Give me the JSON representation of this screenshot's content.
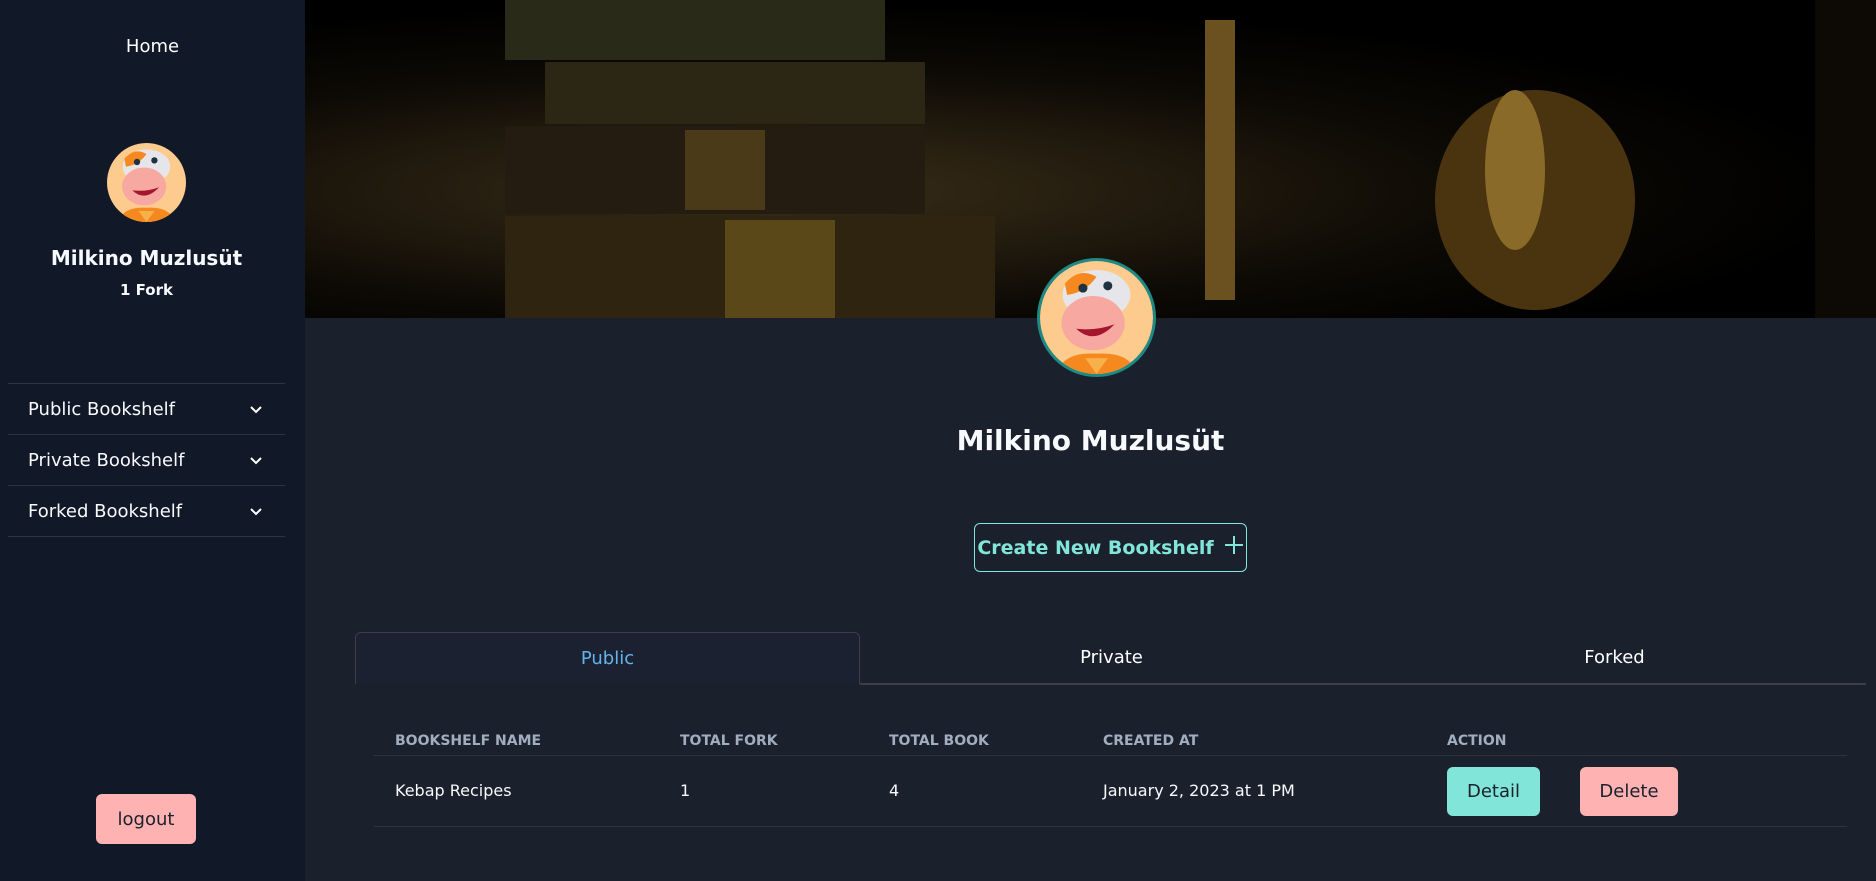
{
  "sidebar": {
    "home": "Home",
    "user_name": "Milkino Muzlusüt",
    "fork_count": "1 Fork",
    "items": [
      {
        "label": "Public Bookshelf"
      },
      {
        "label": "Private Bookshelf"
      },
      {
        "label": "Forked Bookshelf"
      }
    ],
    "logout": "logout"
  },
  "profile": {
    "name": "Milkino Muzlusüt",
    "create_button": "Create New Bookshelf"
  },
  "tabs": [
    {
      "label": "Public"
    },
    {
      "label": "Private"
    },
    {
      "label": "Forked"
    }
  ],
  "table": {
    "headers": [
      "BOOKSHELF NAME",
      "TOTAL FORK",
      "TOTAL BOOK",
      "CREATED AT",
      "ACTION"
    ],
    "rows": [
      {
        "name": "Kebap Recipes",
        "forks": "1",
        "books": "4",
        "created": "January 2, 2023 at 1 PM",
        "detail": "Detail",
        "delete": "Delete"
      }
    ]
  },
  "colors": {
    "accent": "#81e6d9",
    "danger": "#feb2b2",
    "active_tab": "#63b3ed"
  }
}
